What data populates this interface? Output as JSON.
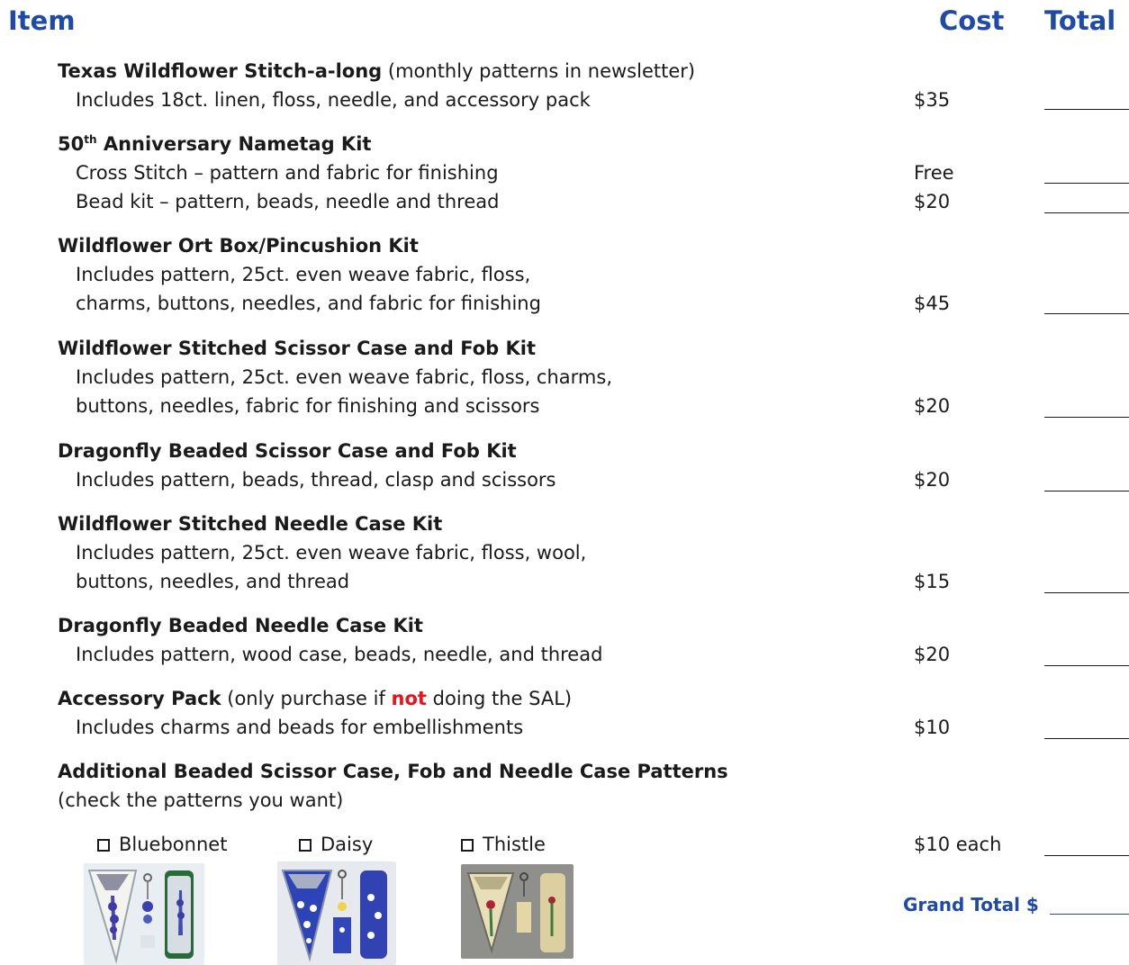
{
  "header": {
    "item": "Item",
    "cost": "Cost",
    "total": "Total"
  },
  "sections": {
    "s1": {
      "title": "Texas Wildflower Stitch-a-long",
      "title_suffix": " (monthly patterns in newsletter)",
      "line1": "Includes 18ct. linen, floss, needle, and accessory pack",
      "cost": "$35"
    },
    "s2": {
      "title_prefix": "50",
      "title_sup": "th",
      "title_rest": " Anniversary Nametag Kit",
      "line1": "Cross Stitch – pattern and fabric for finishing",
      "cost1": "Free",
      "line2": "Bead kit – pattern, beads, needle and thread",
      "cost2": "$20"
    },
    "s3": {
      "title": "Wildflower Ort Box/Pincushion Kit",
      "line1": "Includes pattern, 25ct. even weave fabric, floss,",
      "line2": "charms, buttons, needles, and fabric for finishing",
      "cost": "$45"
    },
    "s4": {
      "title": "Wildflower Stitched Scissor Case and Fob Kit",
      "line1": "Includes pattern, 25ct. even weave fabric, floss, charms,",
      "line2": "buttons, needles, fabric for finishing and scissors",
      "cost": "$20"
    },
    "s5": {
      "title": "Dragonfly Beaded Scissor Case and Fob Kit",
      "line1": "Includes pattern, beads, thread, clasp and scissors",
      "cost": "$20"
    },
    "s6": {
      "title": "Wildflower Stitched Needle Case Kit",
      "line1": "Includes pattern, 25ct. even weave fabric, floss, wool,",
      "line2": "buttons, needles, and thread",
      "cost": "$15"
    },
    "s7": {
      "title": "Dragonfly Beaded Needle Case Kit",
      "line1": "Includes pattern, wood case, beads, needle, and thread",
      "cost": "$20"
    },
    "s8": {
      "title": "Accessory Pack",
      "note_a": " (only purchase if ",
      "note_not": "not",
      "note_b": " doing the SAL)",
      "line1": "Includes charms and beads for embellishments",
      "cost": "$10"
    },
    "s9": {
      "title": "Additional Beaded Scissor Case, Fob and Needle Case Patterns",
      "line1": "(check the patterns you want)",
      "cost": "$10 each"
    }
  },
  "patterns": [
    {
      "label": "Bluebonnet",
      "icon": "checkbox-icon"
    },
    {
      "label": "Daisy",
      "icon": "checkbox-icon"
    },
    {
      "label": "Thistle",
      "icon": "checkbox-icon"
    }
  ],
  "grand_total": {
    "label": "Grand Total",
    "symbol": "$"
  },
  "colors": {
    "header_blue": "#1f4aa8",
    "accent_red": "#e8141c"
  }
}
